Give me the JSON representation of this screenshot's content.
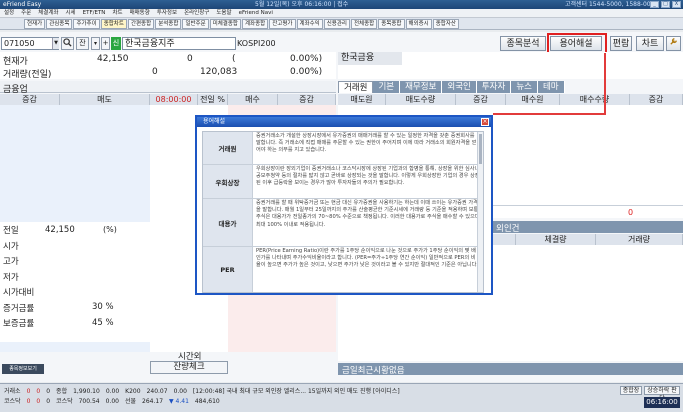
{
  "titlebar": {
    "app_title": "eFriend Easy",
    "notice": "5월 12일(목) 오후 06:16:00 | 접수",
    "phone": "고객센터 1544-5000, 1588-0012",
    "min": "_",
    "max": "□",
    "close": "X"
  },
  "menubar": [
    "설정",
    "주문",
    "체결계좌",
    "시세",
    "ETF/ETN",
    "차트",
    "매매동향",
    "투자정보",
    "온라인창구",
    "도움말",
    "eFriend Navi"
  ],
  "toolbar": [
    "현재가",
    "관심종목",
    "주가추이",
    "종합차트",
    "간편종합",
    "분석종합",
    "일반주문",
    "미체결종합",
    "계좌종합",
    "잔고평가",
    "계좌수익",
    "신용관리",
    "전체종합",
    "종목종합",
    "해외증시",
    "종합자산"
  ],
  "stock": {
    "code": "071050",
    "search_icon": "search-icon",
    "lock_label": "잔",
    "chevron": "▾",
    "plus_label": "+",
    "badge": "신",
    "name": "한국금융지주",
    "market": "KOSPI200"
  },
  "right_buttons": {
    "analysis": "종목분석",
    "glossary": "용어해설",
    "order": "편람",
    "chart": "차트",
    "settings_icon": "wrench-icon"
  },
  "price_info": {
    "current_label": "현재가",
    "current_value": "42,150",
    "change": "0",
    "paren_open": "(",
    "change_rate": "0.00%)",
    "volume_label": "거래량(전일)",
    "volume": "0",
    "prev_volume": "120,083",
    "volume_rate": "0.00%)"
  },
  "right_info": {
    "name": "한국금융"
  },
  "left_orderbook": {
    "title": "금융업",
    "headers": [
      "증감",
      "매도",
      "08:00:00",
      "전일 %",
      "매수",
      "증감"
    ],
    "bottom_label": "시간외",
    "bottom_button": "잔량체크",
    "summary_labels": [
      "전일",
      "시가",
      "고가",
      "저가",
      "시가대비",
      "증거금률",
      "보증금률"
    ],
    "summary_values": [
      "42,150",
      "",
      "",
      "",
      "",
      "30 %",
      "45 %"
    ],
    "unit": "(%)"
  },
  "right_tabs": [
    "거래원",
    "기본",
    "재무정보",
    "외국인",
    "투자자",
    "뉴스",
    "테마"
  ],
  "right_table_headers": [
    "매도원",
    "매도수량",
    "증감",
    "매수원",
    "매수수량",
    "증감"
  ],
  "right_zeros": [
    "0",
    "0"
  ],
  "right_lower": {
    "tab_label": "외인건",
    "headers": [
      "체결량",
      "거래량"
    ]
  },
  "right_bottom_label": "금일최근시황없음",
  "dialog": {
    "title": "용어해설",
    "close": "×",
    "rows": [
      {
        "term": "거래원",
        "desc": "증권거래소가 개설한 상장시장에서 유가증권의 매매거래를 할 수 있는 일정한 자격을 갖춘 증권회사를 말합니다. 즉 거래소에 직접 매매를 주문할 수 있는 권한이 주어지며 이에 따라 거래소의 회원자격을 얻어야 하는 의무를 지고 있습니다."
      },
      {
        "term": "우회상장",
        "desc": "우회상장이란 장외기업이 증권거래소나 코스닥시장에 상장된 기업과의 합병을 통해, 상장을 위한 심사나 공모주청약 등의 절차를 밟지 않고 곧바로 상장되는 것을 말합니다. 이렇게 우회상장한 기업의 경우 상장된 이후 급등락을 보이는 경우가 많아 투자자들의 주의가 필요합니다."
      },
      {
        "term": "대용가",
        "desc": "증권거래를 할 때 위탁증거금 또는 현금 대신 유가증권을 사용하기는 하는데 이때 쓰이는 유가증권 가격을 말합니다. 매월 1일부터 25일까지의 주가를 산술평균한 기준시세에 거래량 등 기준을 적용하며 보통 주식은 대용가가 전일종가의 70~80% 수준으로 책정됩니다. 이러한 대용가로 주식을 매수할 수 있으며 최대 100% 이내로 적용됩니다."
      },
      {
        "term": "PER",
        "desc": "PER(Price Earning Ratio)이란 주가를 1주당 순이익으로 나눈 것으로 주가가 1주당 순이익의 몇 배인가를 나타내며 주가수익비율이라고 합니다. (PER=주가÷1주당 연간 순이익) 일반적으로 PER의 비율이 높으면 주가가 높은 것이고, 낮으면 주가가 낮은 것이라고 볼 수 있지만 절대적인 기준은 아닙니다."
      }
    ]
  },
  "statusbar": {
    "row1": [
      "거래소",
      "0",
      "0",
      "0",
      "종합",
      "1,990.10",
      "0.00",
      "K200",
      "240.07",
      "0.00",
      "[12:00:48] 국내 최대 규모 외인장 엘리스... 15일까지 외인 매도 진행 [아이디스]"
    ],
    "row2": [
      "코스닥",
      "0",
      "0",
      "0",
      "코스닥",
      "700.54",
      "0.00",
      "선물",
      "264.17",
      "▼ 4.41",
      "484,610"
    ],
    "buttons": [
      "종합장",
      "상승하락 판단"
    ],
    "time": "06:16:00"
  }
}
